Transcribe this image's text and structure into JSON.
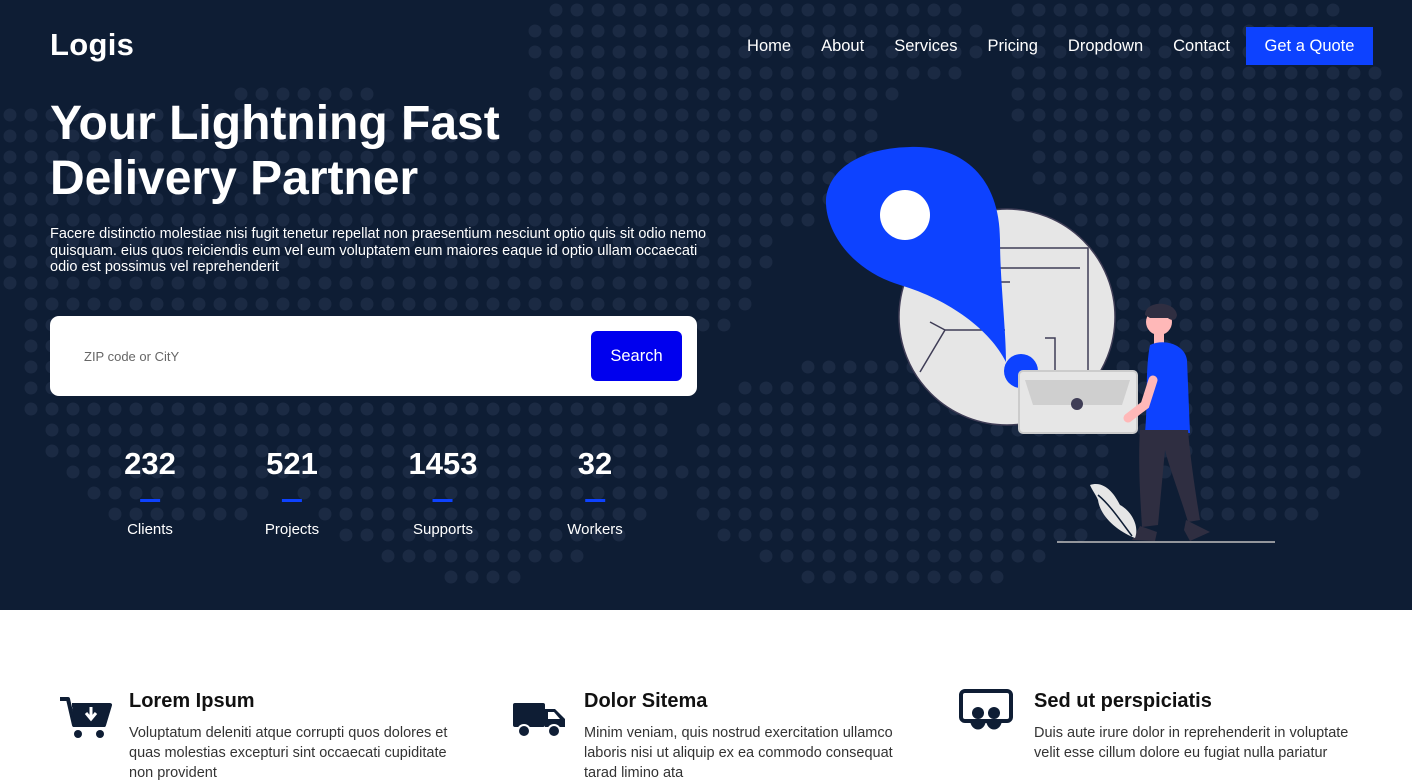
{
  "brand": "Logis",
  "nav": {
    "links": [
      "Home",
      "About",
      "Services",
      "Pricing",
      "Dropdown",
      "Contact"
    ],
    "cta": "Get a Quote"
  },
  "hero": {
    "title": "Your Lightning Fast Delivery Partner",
    "description": "Facere distinctio molestiae nisi fugit tenetur repellat non praesentium nesciunt optio quis sit odio nemo quisquam. eius quos reiciendis eum vel eum voluptatem eum maiores eaque id optio ullam occaecati odio est possimus vel reprehenderit"
  },
  "search": {
    "placeholder": "ZIP code or CitY",
    "button": "Search"
  },
  "stats": [
    {
      "value": "232",
      "label": "Clients"
    },
    {
      "value": "521",
      "label": "Projects"
    },
    {
      "value": "1453",
      "label": "Supports"
    },
    {
      "value": "32",
      "label": "Workers"
    }
  ],
  "features": [
    {
      "icon": "cart-download-icon",
      "title": "Lorem Ipsum",
      "text": "Voluptatum deleniti atque corrupti quos dolores et quas molestias excepturi sint occaecati cupiditate non provident"
    },
    {
      "icon": "truck-icon",
      "title": "Dolor Sitema",
      "text": "Minim veniam, quis nostrud exercitation ullamco laboris nisi ut aliquip ex ea commodo consequat tarad limino ata"
    },
    {
      "icon": "people-icon",
      "title": "Sed ut perspiciatis",
      "text": "Duis aute irure dolor in reprehenderit in voluptate velit esse cillum dolore eu fugiat nulla pariatur"
    }
  ],
  "colors": {
    "hero_bg": "#0e1d34",
    "accent": "#0d42ff",
    "search_button": "#0000ee"
  }
}
